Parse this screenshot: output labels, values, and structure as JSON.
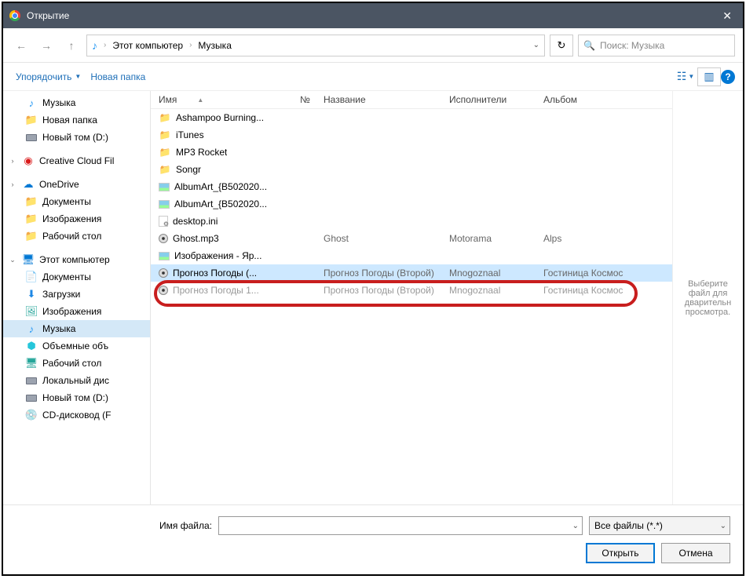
{
  "title": "Открытие",
  "breadcrumb": {
    "root": "Этот компьютер",
    "current": "Музыка"
  },
  "search": {
    "placeholder": "Поиск: Музыка"
  },
  "toolbar": {
    "organize": "Упорядочить",
    "newfolder": "Новая папка"
  },
  "sidebar": [
    {
      "icon": "music",
      "label": "Музыка",
      "indent": 1
    },
    {
      "icon": "folder",
      "label": "Новая папка",
      "indent": 1
    },
    {
      "icon": "drive",
      "label": "Новый том (D:)",
      "indent": 1
    },
    {
      "icon": "cc",
      "label": "Creative Cloud Fil",
      "indent": 0,
      "exp": ">"
    },
    {
      "icon": "cloud",
      "label": "OneDrive",
      "indent": 0,
      "exp": ">"
    },
    {
      "icon": "folder",
      "label": "Документы",
      "indent": 1
    },
    {
      "icon": "folder",
      "label": "Изображения",
      "indent": 1
    },
    {
      "icon": "folder",
      "label": "Рабочий стол",
      "indent": 1
    },
    {
      "icon": "pc",
      "label": "Этот компьютер",
      "indent": 0,
      "exp": "v"
    },
    {
      "icon": "doc",
      "label": "Документы",
      "indent": 1
    },
    {
      "icon": "dl",
      "label": "Загрузки",
      "indent": 1
    },
    {
      "icon": "img",
      "label": "Изображения",
      "indent": 1
    },
    {
      "icon": "music",
      "label": "Музыка",
      "indent": 1,
      "sel": true
    },
    {
      "icon": "3d",
      "label": "Объемные объ",
      "indent": 1
    },
    {
      "icon": "desk",
      "label": "Рабочий стол",
      "indent": 1
    },
    {
      "icon": "drive",
      "label": "Локальный дис",
      "indent": 1
    },
    {
      "icon": "drive",
      "label": "Новый том (D:)",
      "indent": 1
    },
    {
      "icon": "cd",
      "label": "CD-дисковод (F",
      "indent": 1
    }
  ],
  "columns": {
    "name": "Имя",
    "num": "№",
    "title": "Название",
    "artist": "Исполнители",
    "album": "Альбом"
  },
  "files": [
    {
      "icon": "folder",
      "name": "Ashampoo Burning..."
    },
    {
      "icon": "folder",
      "name": "iTunes"
    },
    {
      "icon": "folder",
      "name": "MP3 Rocket"
    },
    {
      "icon": "folder",
      "name": "Songr"
    },
    {
      "icon": "img",
      "name": "AlbumArt_{B502020..."
    },
    {
      "icon": "img",
      "name": "AlbumArt_{B502020..."
    },
    {
      "icon": "ini",
      "name": "desktop.ini"
    },
    {
      "icon": "audio",
      "name": "Ghost.mp3",
      "title": "Ghost",
      "artist": "Motorama",
      "album": "Alps"
    },
    {
      "icon": "img",
      "name": "Изображения - Яр..."
    },
    {
      "icon": "audio",
      "name": "Прогноз Погоды (...",
      "title": "Прогноз Погоды (Второй)",
      "artist": "Mnogoznaal",
      "album": "Гостиница Космос",
      "hl": true
    },
    {
      "icon": "audio",
      "name": "Прогноз Погоды 1...",
      "title": "Прогноз Погоды (Второй)",
      "artist": "Mnogoznaal",
      "album": "Гостиница Космос",
      "dim": true
    }
  ],
  "preview": "Выберите файл для дварительн просмотра.",
  "bottom": {
    "filename_label": "Имя файла:",
    "filename_value": "",
    "filter": "Все файлы (*.*)",
    "open": "Открыть",
    "cancel": "Отмена"
  }
}
